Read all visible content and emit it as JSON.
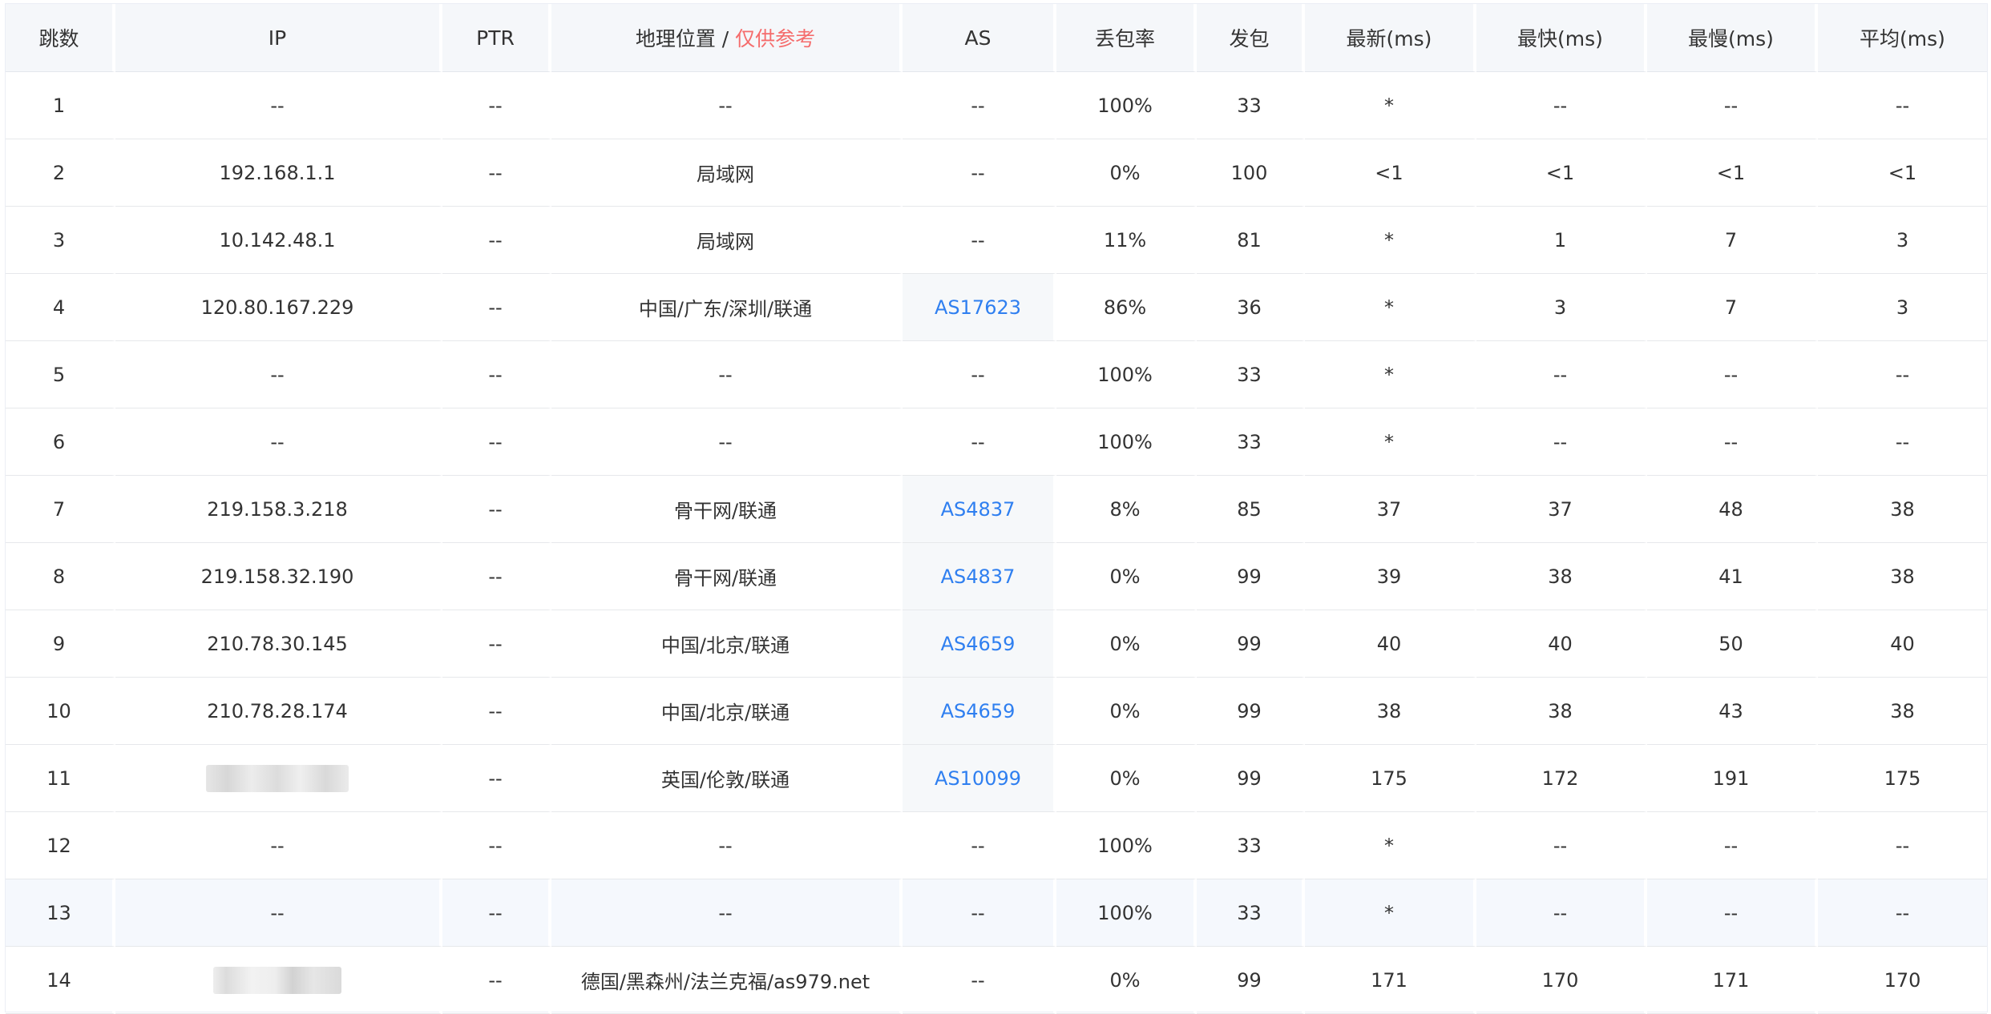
{
  "headers": {
    "hop": "跳数",
    "ip": "IP",
    "ptr": "PTR",
    "geo": "地理位置",
    "geo_sep": " / ",
    "geo_note": "仅供参考",
    "as": "AS",
    "loss": "丢包率",
    "sent": "发包",
    "last": "最新(ms)",
    "best": "最快(ms)",
    "worst": "最慢(ms)",
    "avg": "平均(ms)"
  },
  "colors": {
    "note_red": "#f56c6c",
    "link_blue": "#2f7ff0",
    "header_bg": "#f5f7fa",
    "highlight_row_bg": "#f5f8fd"
  },
  "redacted_icon": "blurred-ip",
  "rows": [
    {
      "hop": "1",
      "ip": "--",
      "ptr": "--",
      "geo": "--",
      "as": "--",
      "loss": "100%",
      "sent": "33",
      "last": "*",
      "best": "--",
      "worst": "--",
      "avg": "--"
    },
    {
      "hop": "2",
      "ip": "192.168.1.1",
      "ptr": "--",
      "geo": "局域网",
      "as": "--",
      "loss": "0%",
      "sent": "100",
      "last": "<1",
      "best": "<1",
      "worst": "<1",
      "avg": "<1"
    },
    {
      "hop": "3",
      "ip": "10.142.48.1",
      "ptr": "--",
      "geo": "局域网",
      "as": "--",
      "loss": "11%",
      "sent": "81",
      "last": "*",
      "best": "1",
      "worst": "7",
      "avg": "3"
    },
    {
      "hop": "4",
      "ip": "120.80.167.229",
      "ptr": "--",
      "geo": "中国/广东/深圳/联通",
      "as": "AS17623",
      "loss": "86%",
      "sent": "36",
      "last": "*",
      "best": "3",
      "worst": "7",
      "avg": "3"
    },
    {
      "hop": "5",
      "ip": "--",
      "ptr": "--",
      "geo": "--",
      "as": "--",
      "loss": "100%",
      "sent": "33",
      "last": "*",
      "best": "--",
      "worst": "--",
      "avg": "--"
    },
    {
      "hop": "6",
      "ip": "--",
      "ptr": "--",
      "geo": "--",
      "as": "--",
      "loss": "100%",
      "sent": "33",
      "last": "*",
      "best": "--",
      "worst": "--",
      "avg": "--"
    },
    {
      "hop": "7",
      "ip": "219.158.3.218",
      "ptr": "--",
      "geo": "骨干网/联通",
      "as": "AS4837",
      "loss": "8%",
      "sent": "85",
      "last": "37",
      "best": "37",
      "worst": "48",
      "avg": "38"
    },
    {
      "hop": "8",
      "ip": "219.158.32.190",
      "ptr": "--",
      "geo": "骨干网/联通",
      "as": "AS4837",
      "loss": "0%",
      "sent": "99",
      "last": "39",
      "best": "38",
      "worst": "41",
      "avg": "38"
    },
    {
      "hop": "9",
      "ip": "210.78.30.145",
      "ptr": "--",
      "geo": "中国/北京/联通",
      "as": "AS4659",
      "loss": "0%",
      "sent": "99",
      "last": "40",
      "best": "40",
      "worst": "50",
      "avg": "40"
    },
    {
      "hop": "10",
      "ip": "210.78.28.174",
      "ptr": "--",
      "geo": "中国/北京/联通",
      "as": "AS4659",
      "loss": "0%",
      "sent": "99",
      "last": "38",
      "best": "38",
      "worst": "43",
      "avg": "38"
    },
    {
      "hop": "11",
      "ip": "",
      "ptr": "--",
      "geo": "英国/伦敦/联通",
      "as": "AS10099",
      "loss": "0%",
      "sent": "99",
      "last": "175",
      "best": "172",
      "worst": "191",
      "avg": "175"
    },
    {
      "hop": "12",
      "ip": "--",
      "ptr": "--",
      "geo": "--",
      "as": "--",
      "loss": "100%",
      "sent": "33",
      "last": "*",
      "best": "--",
      "worst": "--",
      "avg": "--"
    },
    {
      "hop": "13",
      "ip": "--",
      "ptr": "--",
      "geo": "--",
      "as": "--",
      "loss": "100%",
      "sent": "33",
      "last": "*",
      "best": "--",
      "worst": "--",
      "avg": "--"
    },
    {
      "hop": "14",
      "ip": "",
      "ptr": "--",
      "geo": "德国/黑森州/法兰克福/as979.net",
      "as": "--",
      "loss": "0%",
      "sent": "99",
      "last": "171",
      "best": "170",
      "worst": "171",
      "avg": "170"
    }
  ]
}
